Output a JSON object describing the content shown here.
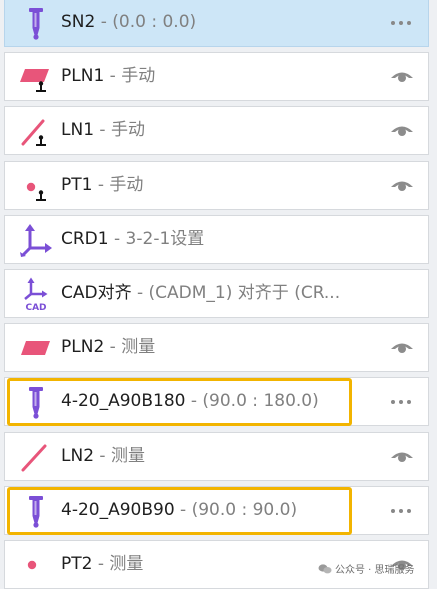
{
  "features": [
    {
      "name": "SN2",
      "detail": "(0.0 : 0.0)",
      "icon": "probe-icon",
      "action": "more",
      "selected": true
    },
    {
      "name": "PLN1",
      "detail": "手动",
      "icon": "plane-manual-icon",
      "action": "eye"
    },
    {
      "name": "LN1",
      "detail": "手动",
      "icon": "line-manual-icon",
      "action": "eye"
    },
    {
      "name": "PT1",
      "detail": "手动",
      "icon": "point-manual-icon",
      "action": "eye"
    },
    {
      "name": "CRD1",
      "detail": "3-2-1设置",
      "icon": "coordinate-system-icon",
      "action": "none"
    },
    {
      "name": "CAD对齐",
      "detail": "(CADM_1) 对齐于 (CR...",
      "icon": "cad-alignment-icon",
      "action": "none"
    },
    {
      "name": "PLN2",
      "detail": "测量",
      "icon": "plane-icon",
      "action": "eye"
    },
    {
      "name": "4-20_A90B180",
      "detail": "(90.0 : 180.0)",
      "icon": "probe-icon",
      "action": "more",
      "highlighted": true
    },
    {
      "name": "LN2",
      "detail": "测量",
      "icon": "line-icon",
      "action": "eye"
    },
    {
      "name": "4-20_A90B90",
      "detail": "(90.0 : 90.0)",
      "icon": "probe-icon",
      "action": "more",
      "highlighted": true
    },
    {
      "name": "PT2",
      "detail": "测量",
      "icon": "point-icon",
      "action": "eye"
    }
  ],
  "separator": " - ",
  "watermark": "公众号 · 思瑞服务",
  "colors": {
    "selected_row": "#cde6f7",
    "highlight": "#f2b400",
    "probe": "#7b4fd6",
    "feature": "#e8557a"
  }
}
